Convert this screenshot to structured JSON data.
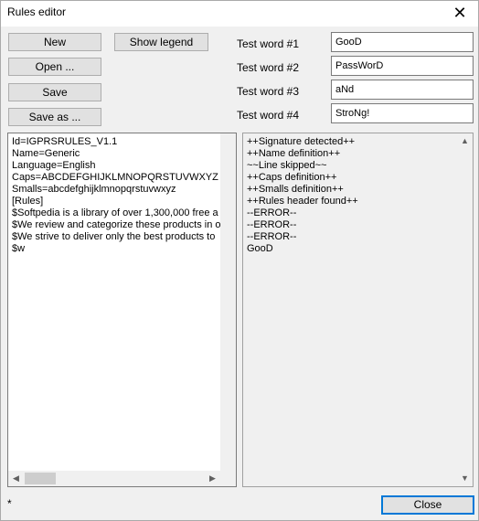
{
  "window": {
    "title": "Rules editor",
    "close_glyph": "✕"
  },
  "buttons": {
    "new": "New",
    "show_legend": "Show legend",
    "open": "Open ...",
    "save": "Save",
    "save_as": "Save as ...",
    "close": "Close"
  },
  "test_words": [
    {
      "label": "Test word #1",
      "value": "GooD"
    },
    {
      "label": "Test word #2",
      "value": "PassWorD"
    },
    {
      "label": "Test word #3",
      "value": "aNd"
    },
    {
      "label": "Test word #4",
      "value": "StroNg!"
    }
  ],
  "rules_lines": [
    "Id=IGPRSRULES_V1.1",
    "Name=Generic",
    "Language=English",
    "Caps=ABCDEFGHIJKLMNOPQRSTUVWXYZ",
    "Smalls=abcdefghijklmnopqrstuvwxyz",
    "[Rules]",
    "$Softpedia is a library of over 1,300,000 free a",
    "$We review and categorize these products in o",
    "$We strive to deliver only the best products to",
    "$w"
  ],
  "output_lines": [
    "++Signature detected++",
    "++Name definition++",
    "~~Line skipped~~",
    "++Caps definition++",
    "++Smalls definition++",
    "++Rules header found++",
    "--ERROR--",
    "--ERROR--",
    "--ERROR--",
    "GooD"
  ],
  "status": {
    "modified_marker": "*"
  },
  "scroll_glyphs": {
    "up": "▲",
    "down": "▼",
    "left": "◀",
    "right": "▶"
  }
}
